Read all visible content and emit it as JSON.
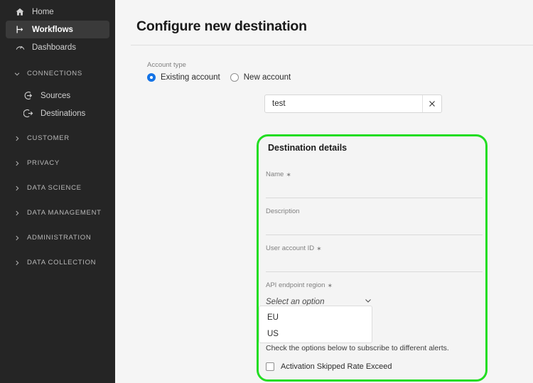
{
  "sidebar": {
    "top_items": [
      {
        "label": "Home",
        "icon": "home-icon",
        "active": false
      },
      {
        "label": "Workflows",
        "icon": "workflows-icon",
        "active": true
      },
      {
        "label": "Dashboards",
        "icon": "dashboards-icon",
        "active": false
      }
    ],
    "connections": {
      "label": "CONNECTIONS",
      "expanded": true,
      "items": [
        {
          "label": "Sources",
          "icon": "sources-icon"
        },
        {
          "label": "Destinations",
          "icon": "destinations-icon"
        }
      ]
    },
    "sections": [
      {
        "label": "CUSTOMER"
      },
      {
        "label": "PRIVACY"
      },
      {
        "label": "DATA SCIENCE"
      },
      {
        "label": "DATA MANAGEMENT"
      },
      {
        "label": "ADMINISTRATION"
      },
      {
        "label": "DATA COLLECTION"
      }
    ]
  },
  "page": {
    "title": "Configure new destination"
  },
  "account_type": {
    "label": "Account type",
    "options": [
      {
        "label": "Existing account",
        "selected": true
      },
      {
        "label": "New account",
        "selected": false
      }
    ],
    "selected_color": "#1473E6"
  },
  "account_picker": {
    "value": "test",
    "clear_icon": "close-icon"
  },
  "details": {
    "title": "Destination details",
    "highlight_color": "#22DD22",
    "fields": [
      {
        "label": "Name",
        "required": true,
        "value": ""
      },
      {
        "label": "Description",
        "required": false,
        "value": ""
      },
      {
        "label": "User account ID",
        "required": true,
        "value": ""
      }
    ],
    "required_marker": "✶",
    "region": {
      "label": "API endpoint region",
      "required": true,
      "placeholder": "Select an option",
      "chevron_icon": "chevron-down-icon",
      "open": true,
      "options": [
        "EU",
        "US"
      ]
    },
    "alerts_note": "Check the options below to subscribe to different alerts.",
    "alerts": [
      {
        "label": "Activation Skipped Rate Exceed",
        "checked": false
      }
    ]
  }
}
